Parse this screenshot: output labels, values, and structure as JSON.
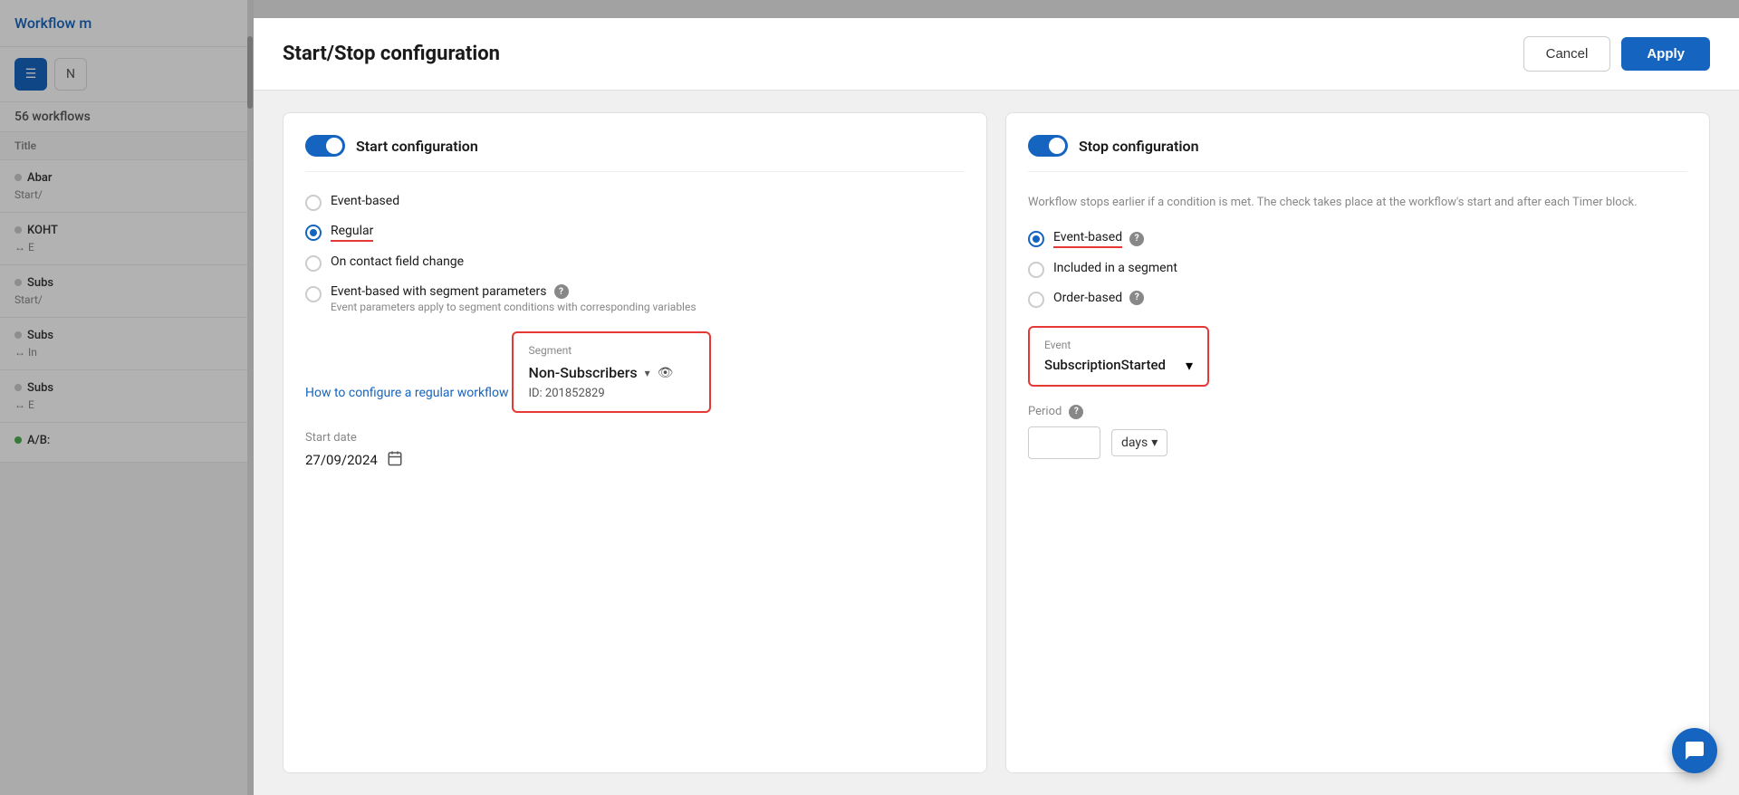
{
  "sidebar": {
    "title": "Workflow m",
    "toolbar": {
      "list_btn": "☰",
      "new_btn": "N"
    },
    "count_label": "workflows",
    "count": "56",
    "table_header": "Title",
    "items": [
      {
        "name": "Abar",
        "sub": "Start/",
        "dot": "gray"
      },
      {
        "name": "KOHT",
        "sub": "↔ E",
        "dot": "gray"
      },
      {
        "name": "Subs",
        "sub": "Start/",
        "dot": "gray"
      },
      {
        "name": "Subs",
        "sub": "↔ In",
        "dot": "gray"
      },
      {
        "name": "Subs",
        "sub": "↔ E",
        "dot": "gray"
      },
      {
        "name": "A/B:",
        "sub": "",
        "dot": "green"
      }
    ]
  },
  "modal": {
    "title": "Start/Stop configuration",
    "cancel_label": "Cancel",
    "apply_label": "Apply"
  },
  "start_config": {
    "title": "Start configuration",
    "toggle_on": true,
    "options": [
      {
        "id": "event-based",
        "label": "Event-based",
        "selected": false,
        "has_help": false
      },
      {
        "id": "regular",
        "label": "Regular",
        "selected": true,
        "underline": true,
        "has_help": false
      },
      {
        "id": "on-contact-field",
        "label": "On contact field change",
        "selected": false,
        "has_help": false
      },
      {
        "id": "event-based-segment",
        "label": "Event-based with segment parameters",
        "selected": false,
        "has_help": true,
        "sub": "Event parameters apply to segment conditions with corresponding variables"
      }
    ],
    "link": "How to configure a regular workflow",
    "segment": {
      "label": "Segment",
      "value": "Non-Subscribers",
      "id": "ID: 201852829"
    },
    "start_date": {
      "label": "Start date",
      "value": "27/09/2024"
    }
  },
  "stop_config": {
    "title": "Stop configuration",
    "toggle_on": true,
    "description": "Workflow stops earlier if a condition is met. The check takes place at the workflow's start and after each Timer block.",
    "options": [
      {
        "id": "event-based",
        "label": "Event-based",
        "selected": true,
        "underline": true,
        "has_help": true
      },
      {
        "id": "included-in-segment",
        "label": "Included in a segment",
        "selected": false,
        "has_help": false
      },
      {
        "id": "order-based",
        "label": "Order-based",
        "selected": false,
        "has_help": true
      }
    ],
    "event": {
      "label": "Event",
      "value": "SubscriptionStarted"
    },
    "period": {
      "label": "Period",
      "has_help": true,
      "unit": "days"
    }
  },
  "chat_button": "💬",
  "icons": {
    "chevron": "▾",
    "eye": "👁",
    "calendar": "📅",
    "help": "?",
    "list": "☰",
    "chat": "💬"
  }
}
